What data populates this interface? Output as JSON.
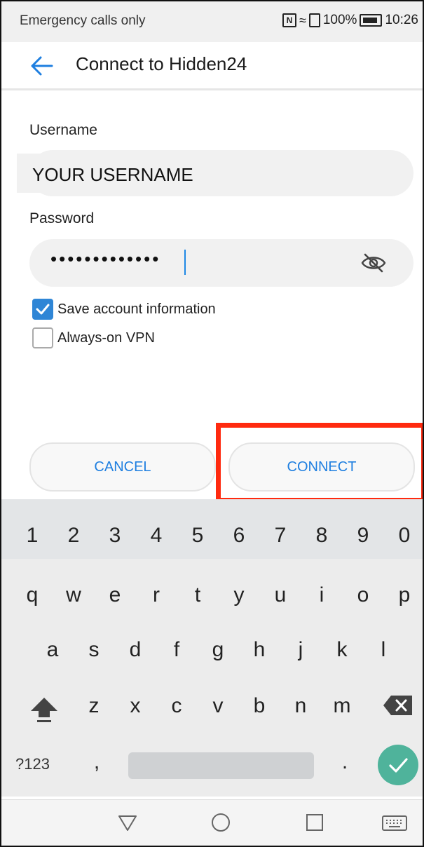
{
  "status_bar": {
    "left_text": "Emergency calls only",
    "battery_text": "100%",
    "time": "10:26"
  },
  "header": {
    "title": "Connect to Hidden24"
  },
  "form": {
    "username_label": "Username",
    "username_value": "YOUR USERNAME",
    "password_label": "Password",
    "password_masked": "•••••••••••••",
    "save_account_label": "Save account information",
    "save_account_checked": true,
    "always_on_vpn_label": "Always-on VPN",
    "always_on_vpn_checked": false
  },
  "buttons": {
    "cancel": "CANCEL",
    "connect": "CONNECT"
  },
  "keyboard": {
    "number_row": [
      "1",
      "2",
      "3",
      "4",
      "5",
      "6",
      "7",
      "8",
      "9",
      "0"
    ],
    "row1": [
      "q",
      "w",
      "e",
      "r",
      "t",
      "y",
      "u",
      "i",
      "o",
      "p"
    ],
    "row2": [
      "a",
      "s",
      "d",
      "f",
      "g",
      "h",
      "j",
      "k",
      "l"
    ],
    "row3": [
      "z",
      "x",
      "c",
      "v",
      "b",
      "n",
      "m"
    ],
    "symbols_key": "?123",
    "comma_key": ",",
    "period_key": "."
  },
  "colors": {
    "accent": "#1f7fe0",
    "checkbox": "#2f86d6",
    "highlight": "#ff2a0f",
    "enter_key": "#4fb39b"
  }
}
